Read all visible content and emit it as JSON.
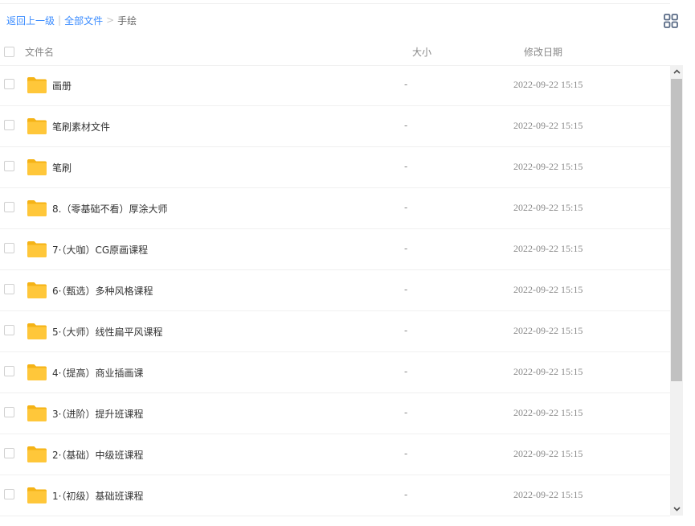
{
  "breadcrumb": {
    "back": "返回上一级",
    "separator1": "|",
    "all_files": "全部文件",
    "separator2": ">",
    "current": "手绘"
  },
  "columns": {
    "name": "文件名",
    "size": "大小",
    "modified": "修改日期"
  },
  "files": [
    {
      "name": "画册",
      "size": "-",
      "modified": "2022-09-22 15:15"
    },
    {
      "name": "笔刷素材文件",
      "size": "-",
      "modified": "2022-09-22 15:15"
    },
    {
      "name": "笔刷",
      "size": "-",
      "modified": "2022-09-22 15:15"
    },
    {
      "name": "8.（零基础不看）厚涂大师",
      "size": "-",
      "modified": "2022-09-22 15:15"
    },
    {
      "name": "7·（大咖）CG原画课程",
      "size": "-",
      "modified": "2022-09-22 15:15"
    },
    {
      "name": "6·（甄选）多种风格课程",
      "size": "-",
      "modified": "2022-09-22 15:15"
    },
    {
      "name": "5·（大师）线性扁平风课程",
      "size": "-",
      "modified": "2022-09-22 15:15"
    },
    {
      "name": "4·（提高）商业插画课",
      "size": "-",
      "modified": "2022-09-22 15:15"
    },
    {
      "name": "3·（进阶）提升班课程",
      "size": "-",
      "modified": "2022-09-22 15:15"
    },
    {
      "name": "2·（基础）中级班课程",
      "size": "-",
      "modified": "2022-09-22 15:15"
    },
    {
      "name": "1·（初级）基础班课程",
      "size": "-",
      "modified": "2022-09-22 15:15"
    }
  ],
  "icons": {
    "folder": "folder-icon",
    "view_toggle": "grid-view-icon",
    "scroll_up": "chevron-up-icon",
    "scroll_down": "chevron-down-icon"
  },
  "colors": {
    "link": "#3b8cff",
    "folder": "#ffc73a",
    "folder_dark": "#f5b316",
    "icon": "#5a6b86"
  }
}
